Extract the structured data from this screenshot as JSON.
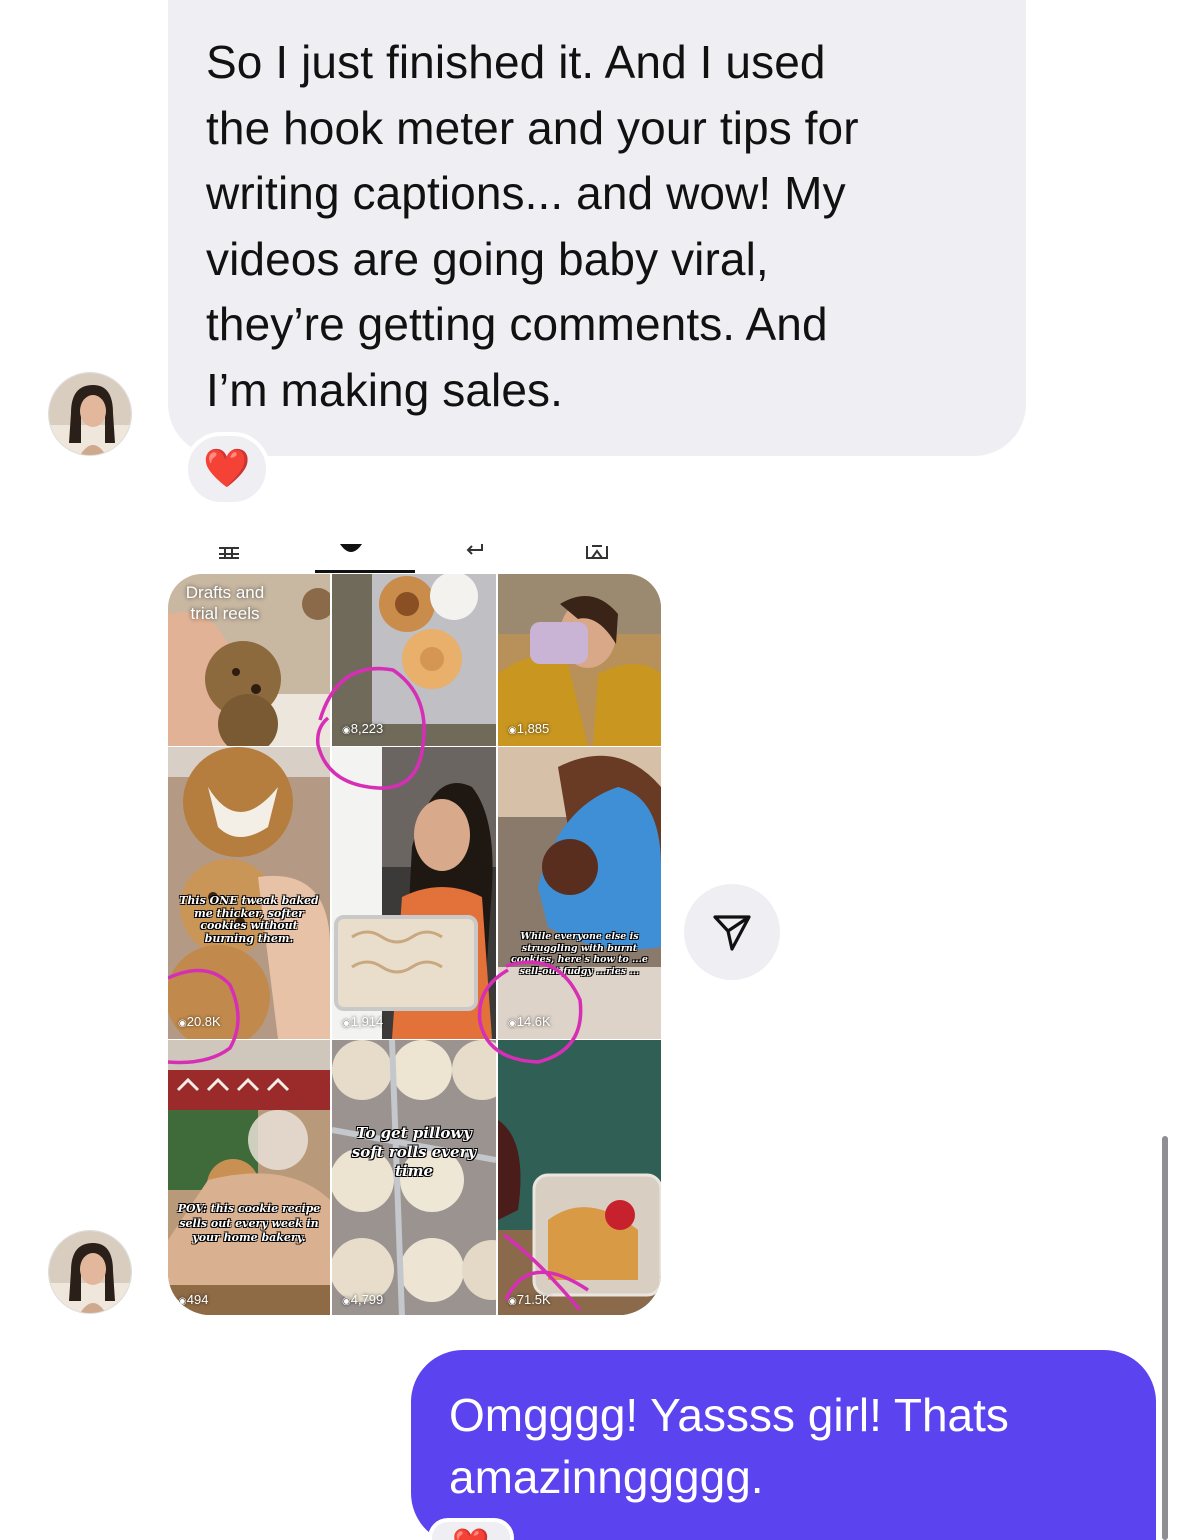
{
  "incoming_message": {
    "text": "So I just finished it. And I used\nthe hook meter and your tips for\nwriting captions... and wow! My\nvideos are going baby viral,\nthey’re getting comments. And\nI’m making sales.",
    "reaction": "❤️"
  },
  "shared_screenshot": {
    "drafts_label": "Drafts and\ntrial reels",
    "tiles": [
      {
        "views": "",
        "caption": ""
      },
      {
        "views": "8,223",
        "caption": ""
      },
      {
        "views": "1,885",
        "caption": ""
      },
      {
        "views": "20.8K",
        "caption": "This ONE tweak baked me thicker, softer cookies without burning them."
      },
      {
        "views": "1,914",
        "caption": ""
      },
      {
        "views": "14.6K",
        "caption": "While everyone else is struggling with burnt cookies, here's how to ...e sell-out fudgy ...ries ..."
      },
      {
        "views": "494",
        "caption": "POV: this cookie recipe sells out every week in your home bakery."
      },
      {
        "views": "4,799",
        "caption": "To get pillowy soft rolls every time"
      },
      {
        "views": "71.5K",
        "caption": ""
      }
    ],
    "annotation_color": "#d62fb5"
  },
  "share_button": {
    "icon": "paper-plane-icon"
  },
  "outgoing_message": {
    "text": "Omgggg! Yassss girl! Thats\namazinnggggg.",
    "bubble_color": "#5b43ef",
    "reaction": "❤️"
  }
}
